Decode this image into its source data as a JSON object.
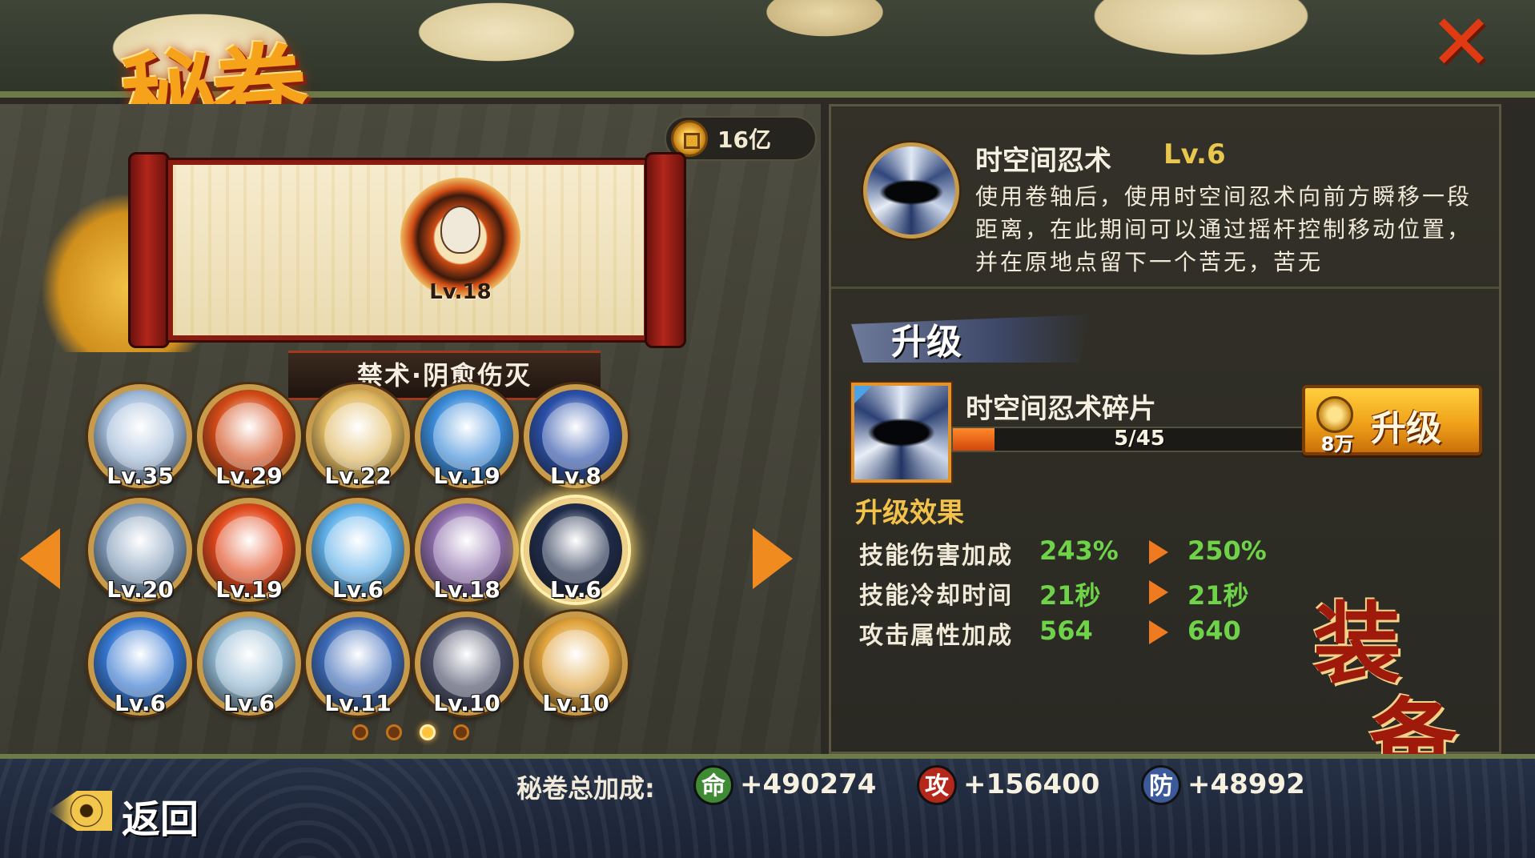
{
  "header": {
    "title": "秘卷",
    "close_icon": "close-x-icon"
  },
  "currency": {
    "amount": "16亿",
    "icon": "coin-icon"
  },
  "featured_scroll": {
    "name": "禁术·阴愈伤灭",
    "level": "Lv.18"
  },
  "skills": [
    {
      "level": "Lv.35",
      "color": "#9fb9d8"
    },
    {
      "level": "Lv.29",
      "color": "#d24a16"
    },
    {
      "level": "Lv.22",
      "color": "#e0b860"
    },
    {
      "level": "Lv.19",
      "color": "#3a8ad8"
    },
    {
      "level": "Lv.8",
      "color": "#2a4fa8"
    },
    {
      "level": "Lv.20",
      "color": "#7f9ab8"
    },
    {
      "level": "Lv.19",
      "color": "#e0461a"
    },
    {
      "level": "Lv.6",
      "color": "#5fb0ea"
    },
    {
      "level": "Lv.18",
      "color": "#8a6aa8"
    },
    {
      "level": "Lv.6",
      "color": "#1e2b4a",
      "selected": true
    },
    {
      "level": "Lv.6",
      "color": "#3476d0"
    },
    {
      "level": "Lv.6",
      "color": "#8fb6d0"
    },
    {
      "level": "Lv.11",
      "color": "#3c6ab8"
    },
    {
      "level": "Lv.10",
      "color": "#4b4f68"
    },
    {
      "level": "Lv.10",
      "color": "#e0a23a"
    }
  ],
  "pagination": {
    "pages": 4,
    "active": 3
  },
  "detail": {
    "name": "时空间忍术",
    "level": "Lv.6",
    "description": "使用卷轴后，使用时空间忍术向前方瞬移一段距离，在此期间可以通过摇杆控制移动位置，并在原地点留下一个苦无，苦无"
  },
  "upgrade": {
    "section_title": "升级",
    "fragment_name": "时空间忍术碎片",
    "progress_text": "5/45",
    "progress_fraction": 0.111,
    "button_label": "升级",
    "cost": "8万"
  },
  "effects": {
    "title": "升级效果",
    "rows": [
      {
        "label": "技能伤害加成",
        "before": "243%",
        "after": "250%"
      },
      {
        "label": "技能冷却时间",
        "before": "21秒",
        "after": "21秒"
      },
      {
        "label": "攻击属性加成",
        "before": "564",
        "after": "640"
      }
    ]
  },
  "equip": {
    "line1": "装",
    "line2": "备"
  },
  "footer": {
    "back_label": "返回",
    "total_label": "秘卷总加成:",
    "stats": [
      {
        "badge": "命",
        "value": "+490274",
        "color": "#3f8a34"
      },
      {
        "badge": "攻",
        "value": "+156400",
        "color": "#b3281a"
      },
      {
        "badge": "防",
        "value": "+48992",
        "color": "#3c5a9a"
      }
    ]
  }
}
